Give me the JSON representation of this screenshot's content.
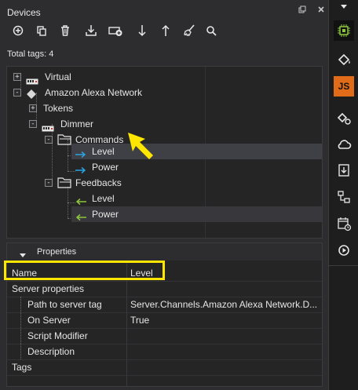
{
  "panel": {
    "title": "Devices",
    "pin_icon": "pin-icon",
    "close_icon": "close-icon"
  },
  "toolbar": {
    "buttons": [
      "add-icon",
      "duplicate-icon",
      "delete-icon",
      "import-icon",
      "add-device-icon",
      "move-down-icon",
      "move-up-icon",
      "clean-icon",
      "search-icon"
    ]
  },
  "status": {
    "total_tags": "Total tags: 4"
  },
  "tree": {
    "nodes": [
      {
        "label": "Virtual",
        "icon": "device-icon",
        "expander": "+"
      },
      {
        "label": "Amazon Alexa Network",
        "icon": "network-icon",
        "expander": "-"
      },
      {
        "label": "Tokens",
        "expander": "+"
      },
      {
        "label": "Dimmer",
        "icon": "device-icon",
        "expander": "-"
      },
      {
        "label": "Commands",
        "icon": "folder-icon",
        "expander": "-"
      },
      {
        "label": "Level",
        "icon": "command-arrow-icon",
        "selected": true
      },
      {
        "label": "Power",
        "icon": "command-arrow-icon"
      },
      {
        "label": "Feedbacks",
        "icon": "folder-icon",
        "expander": "-"
      },
      {
        "label": "Level",
        "icon": "feedback-arrow-icon"
      },
      {
        "label": "Power",
        "icon": "feedback-arrow-icon",
        "highlighted": true
      }
    ]
  },
  "properties": {
    "title": "Properties",
    "rows": [
      {
        "name": "Name",
        "value": "Level"
      },
      {
        "name": "Server properties",
        "value": ""
      },
      {
        "name": "Path to server tag",
        "value": "Server.Channels.Amazon Alexa Network.D..."
      },
      {
        "name": "On Server",
        "value": "True"
      },
      {
        "name": "Script Modifier",
        "value": ""
      },
      {
        "name": "Description",
        "value": ""
      },
      {
        "name": "Tags",
        "value": ""
      }
    ]
  },
  "right_bar": {
    "buttons": [
      "chip-icon",
      "paint-bucket-icon",
      "js-icon",
      "paint-settings-icon",
      "cloud-icon",
      "download-icon",
      "hierarchy-icon",
      "calendar-clock-icon",
      "play-circle-icon"
    ],
    "js_label": "JS"
  },
  "colors": {
    "accent": "#2aa3e0",
    "feedback": "#8cc63f",
    "highlight": "#ffe600",
    "js_bg": "#e06c1a"
  }
}
